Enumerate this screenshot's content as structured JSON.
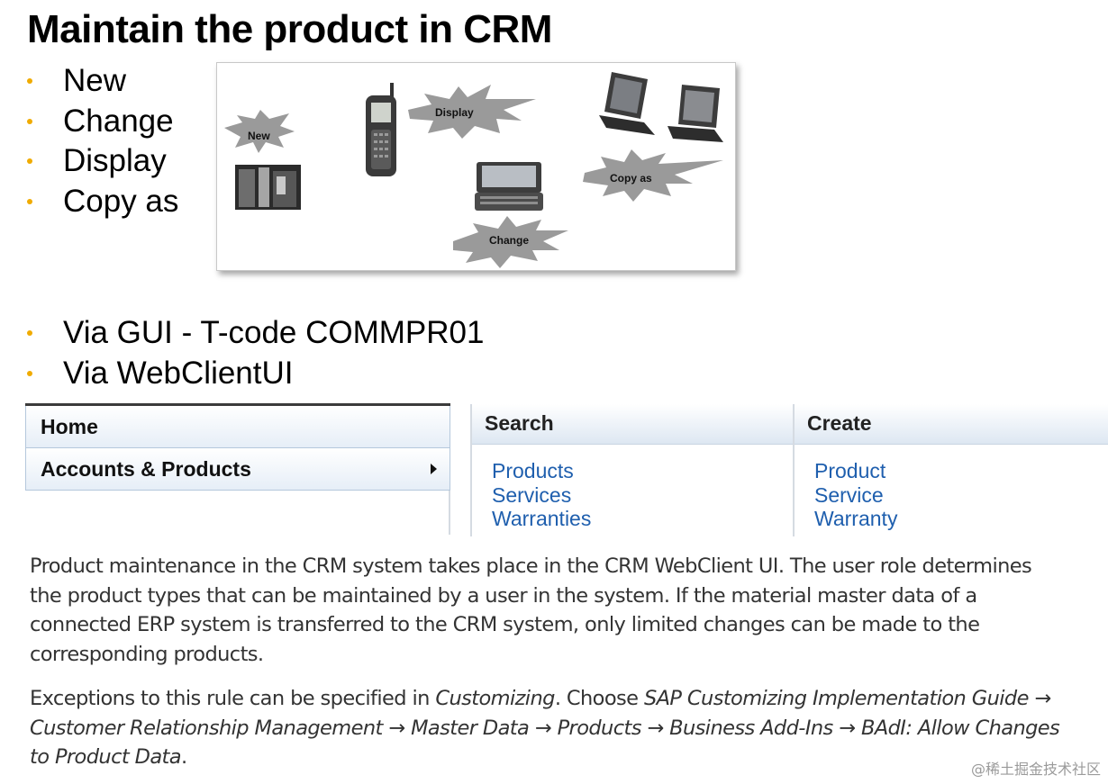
{
  "title": "Maintain the product in CRM",
  "bullets_top": [
    "New",
    "Change",
    "Display",
    "Copy as"
  ],
  "illustration": {
    "labels": [
      "New",
      "Display",
      "Copy as",
      "Change"
    ]
  },
  "bullets_bottom": [
    "Via GUI - T-code COMMPR01",
    "Via WebClientUI"
  ],
  "navigation": {
    "items": [
      "Home",
      "Accounts & Products"
    ]
  },
  "search": {
    "header": "Search",
    "links": [
      "Products",
      "Services",
      "Warranties"
    ]
  },
  "create": {
    "header": "Create",
    "links": [
      "Product",
      "Service",
      "Warranty"
    ]
  },
  "paragraph1": "Product maintenance in the CRM system takes place in the CRM WebClient UI. The user role determines the product types that can be maintained by a user in the system. If the material master data of a connected ERP system is transferred to the CRM system, only limited changes can be made to the corresponding products.",
  "paragraph2": {
    "prefix": "Exceptions to this rule can be specified in ",
    "customizing": "Customizing",
    "choose": ". Choose ",
    "path": "SAP Customizing Implementation Guide → Customer Relationship Management → Master Data → Products → Business Add-Ins → BAdI: Allow Changes to Product Data",
    "end": "."
  },
  "watermark": "@稀土掘金技术社区"
}
